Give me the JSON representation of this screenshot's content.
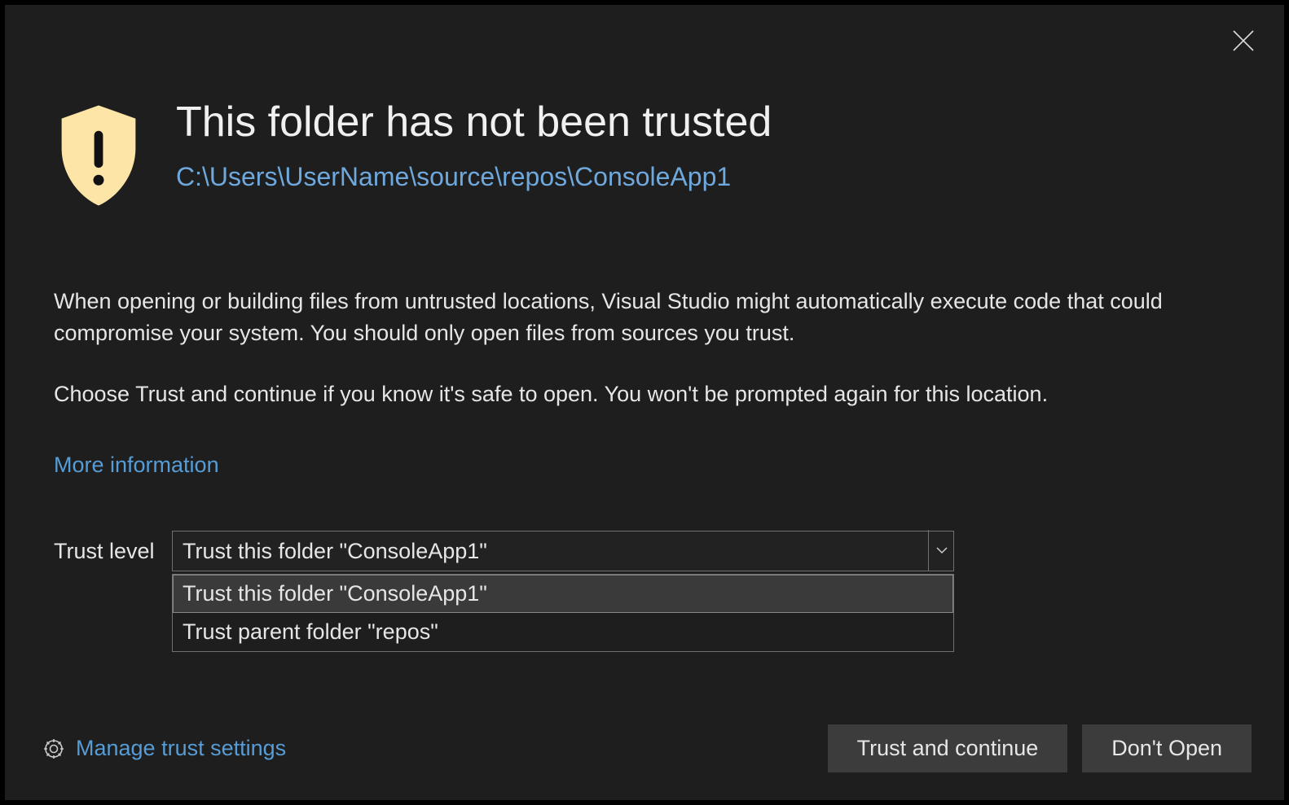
{
  "header": {
    "title": "This folder has not been trusted",
    "path": "C:\\Users\\UserName\\source\\repos\\ConsoleApp1"
  },
  "body": {
    "paragraph1": "When opening or building files from untrusted locations, Visual Studio might automatically execute code that could compromise your system. You should only open files from sources you trust.",
    "paragraph2": "Choose Trust and continue if you know it's safe to open. You won't be prompted again for this location.",
    "more_info": "More information"
  },
  "trust": {
    "label": "Trust level",
    "selected": "Trust this folder \"ConsoleApp1\"",
    "options": [
      "Trust this folder \"ConsoleApp1\"",
      "Trust parent folder \"repos\""
    ]
  },
  "footer": {
    "manage": "Manage trust settings",
    "primary": "Trust and continue",
    "secondary": "Don't Open"
  },
  "colors": {
    "background": "#1e1e1e",
    "link": "#569cd6",
    "shield": "#fce5a7"
  }
}
